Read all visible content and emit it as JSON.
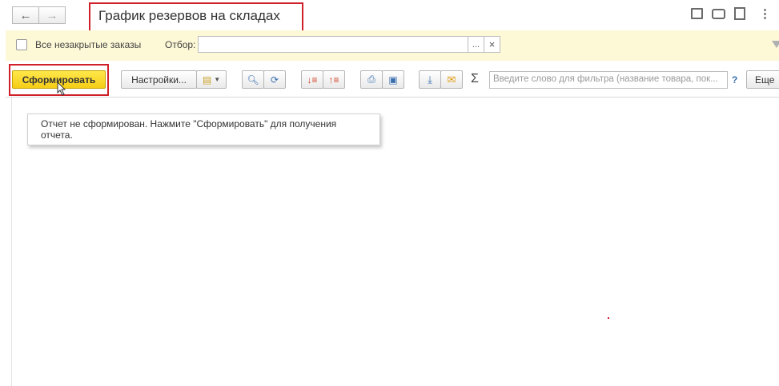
{
  "window": {
    "title": "График резервов на складах"
  },
  "nav": {
    "back_icon": "←",
    "forward_icon": "→"
  },
  "toolbar_top": {
    "icons": [
      "save-icon",
      "print-icon",
      "preview-icon",
      "more-icon"
    ]
  },
  "filter": {
    "checkbox_label": "Все незакрытые заказы",
    "checked": false,
    "selection_label": "Отбор:",
    "selection_value": "",
    "choose_label": "...",
    "clear_label": "×"
  },
  "actions": {
    "generate_label": "Сформировать",
    "settings_label": "Настройки...",
    "search_placeholder": "Введите слово для фильтра (название товара, пок...",
    "help_label": "?",
    "more_label": "Еще",
    "sum_symbol": "Σ"
  },
  "report": {
    "message": "Отчет не сформирован. Нажмите \"Сформировать\" для получения отчета."
  },
  "colors": {
    "accent_yellow": "#f5cd16",
    "highlight_red": "#d0202a",
    "filter_bg": "#fdf8d6"
  }
}
